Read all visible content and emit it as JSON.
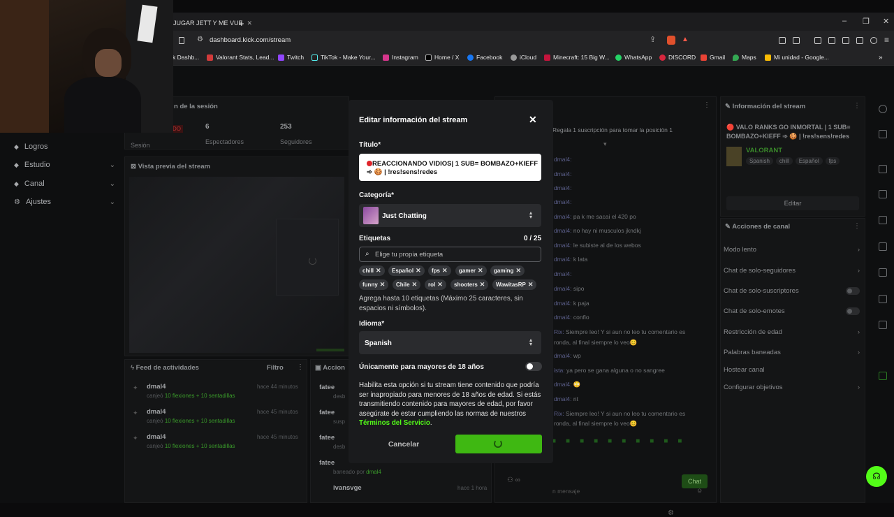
{
  "browser": {
    "tab_title": "JUGAR JETT Y ME VUE",
    "url": "dashboard.kick.com/stream",
    "bookmarks": [
      "k Dashb...",
      "Valorant Stats, Lead...",
      "Twitch",
      "TikTok - Make Your...",
      "Instagram",
      "Home / X",
      "Facebook",
      "iCloud",
      "Minecraft: 15 Big W...",
      "WhatsApp",
      "DISCORD",
      "Gmail",
      "Maps",
      "Mi unidad - Google..."
    ],
    "colors": {
      "bg": "#1c1c1e",
      "toolbar": "#232325"
    }
  },
  "sidebar": {
    "items": [
      {
        "label": "Logros",
        "icon": "trophy-icon"
      },
      {
        "label": "Estudio",
        "icon": "video-icon"
      },
      {
        "label": "Canal",
        "icon": "broadcast-icon"
      },
      {
        "label": "Ajustes",
        "icon": "gear-icon"
      }
    ]
  },
  "session": {
    "title": "n de la sesión",
    "badge": "DO",
    "stats": [
      {
        "value": "",
        "label": "Sesión"
      },
      {
        "value": "6",
        "label": "Espectadores"
      },
      {
        "value": "253",
        "label": "Seguidores"
      }
    ]
  },
  "preview": {
    "title": "Vista previa del stream"
  },
  "feed": {
    "title": "Feed de actividades",
    "filter": "Filtro",
    "items": [
      {
        "user": "dmal4",
        "time": "hace 44 minutos",
        "action": "canjeó",
        "reward": "10 flexiones + 10 sentadillas"
      },
      {
        "user": "dmal4",
        "time": "hace 45 minutos",
        "action": "canjeó",
        "reward": "10 flexiones + 10 sentadillas"
      },
      {
        "user": "dmal4",
        "time": "hace 45 minutos",
        "action": "canjeó",
        "reward": "10 flexiones + 10 sentadillas"
      }
    ]
  },
  "actions_log": {
    "title": "Accion",
    "items": [
      {
        "user": "fatee",
        "sub": "desb"
      },
      {
        "user": "fatee",
        "sub": "susp"
      },
      {
        "user": "fatee",
        "sub": "desb"
      },
      {
        "user": "fatee",
        "sub": "baneado por",
        "by": "dmal4"
      },
      {
        "user": "ivansvge",
        "sub": "",
        "time": "hace 1 hora"
      }
    ]
  },
  "chat": {
    "pinned": "Regala 1 suscripción para tomar la posición 1",
    "lines": [
      {
        "user": "dmal4:",
        "text": ""
      },
      {
        "user": "dmal4:",
        "text": ""
      },
      {
        "user": "dmal4:",
        "text": ""
      },
      {
        "user": "dmal4:",
        "text": ""
      },
      {
        "user": "dmal4:",
        "text": "pa k me sacai el 420 po"
      },
      {
        "user": "dmal4:",
        "text": "no hay ni musculos jkndkj"
      },
      {
        "user": "dmal4:",
        "text": "le subiste al de los webos"
      },
      {
        "user": "dmal4:",
        "text": "k lata"
      },
      {
        "user": "dmal4:",
        "text": ""
      },
      {
        "user": "dmal4:",
        "text": "sipo"
      },
      {
        "user": "dmal4:",
        "text": "k paja"
      },
      {
        "user": "dmal4:",
        "text": "confio"
      },
      {
        "user": "Rix:",
        "text": "Siempre leo! Y si aun no leo tu comentario es"
      },
      {
        "user": "",
        "text": "ronda, al final siempre lo veo😊"
      },
      {
        "user": "dmal4:",
        "text": "wp"
      },
      {
        "user": "ista:",
        "text": "ya pero se gana alguna o no sangree"
      },
      {
        "user": "dmal4:",
        "text": "😳"
      },
      {
        "user": "dmal4:",
        "text": "nt"
      },
      {
        "user": "Rix:",
        "text": "Siempre leo! Y si aun no leo tu comentario es"
      },
      {
        "user": "",
        "text": "ronda, al final siempre lo veo😊"
      }
    ],
    "input_placeholder": "n mensaje",
    "send_label": "Chat"
  },
  "stream_info": {
    "title": "Información del stream",
    "stream_title": "🔴 VALO RANKS GO INMORTAL | 1 SUB= BOMBAZO+KIEFF ➾ 🍪 | !res!sens!redes",
    "game": "VALORANT",
    "tags": [
      "Spanish",
      "chill",
      "Español",
      "fps"
    ],
    "edit_label": "Editar"
  },
  "channel_actions": {
    "title": "Acciones de canal",
    "items": [
      {
        "label": "Modo lento",
        "kind": "chevron"
      },
      {
        "label": "Chat de solo-seguidores",
        "kind": "chevron"
      },
      {
        "label": "Chat de solo-suscriptores",
        "kind": "toggle"
      },
      {
        "label": "Chat de solo-emotes",
        "kind": "toggle"
      },
      {
        "label": "Restricción de edad",
        "kind": "chevron"
      },
      {
        "label": "Palabras baneadas",
        "kind": "chevron"
      },
      {
        "label": "Hostear canal",
        "kind": "none"
      },
      {
        "label": "Configurar objetivos",
        "kind": "chevron"
      }
    ]
  },
  "modal": {
    "title": "Editar información del stream",
    "title_label": "Título*",
    "title_value_line1": "REACCIONANDO VIDIOS| 1 SUB= BOMBAZO+KIEFF",
    "title_value_line2": "➾ 🍪 | !res!sens!redes",
    "category_label": "Categoría*",
    "category_value": "Just Chatting",
    "tags_label": "Etiquetas",
    "tags_count": "0 / 25",
    "tags_placeholder": "Elige tu propia etiqueta",
    "tags": [
      "chill",
      "Español",
      "fps",
      "gamer",
      "gaming",
      "funny",
      "Chile",
      "rol",
      "shooters",
      "WawitasRP"
    ],
    "tags_help": "Agrega hasta 10 etiquetas (Máximo 25 caracteres, sin espacios ni símbolos).",
    "language_label": "Idioma*",
    "language_value": "Spanish",
    "adult_label": "Únicamente para mayores de 18 años",
    "adult_help": "Habilita esta opción si tu stream tiene contenido que podría ser inapropiado para menores de 18 años de edad. Si estás transmitiendo contenido para mayores de edad, por favor asegúrate de estar cumpliendo las normas de nuestros",
    "terms_link": "Términos del Servicio",
    "terms_end": ".",
    "cancel_label": "Cancelar",
    "accent": "#53fc18"
  }
}
